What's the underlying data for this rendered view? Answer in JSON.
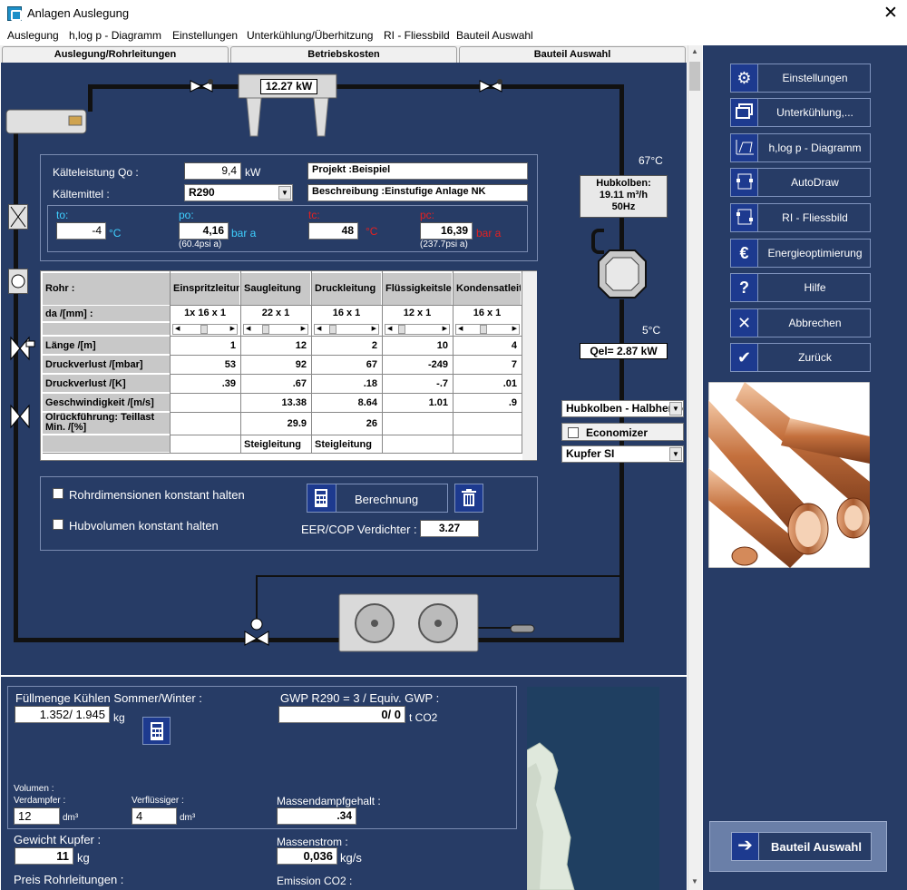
{
  "window": {
    "title": "Anlagen Auslegung",
    "close": "✕"
  },
  "menu": [
    "Auslegung",
    "h,log p - Diagramm",
    "Einstellungen",
    "Unterkühlung/Überhitzung",
    "RI - Fliessbild",
    "Bauteil Auswahl"
  ],
  "tabs": [
    "Auslegung/Rohrleitungen",
    "Betriebskosten",
    "Bauteil Auswahl"
  ],
  "diagram": {
    "condenser_power": "12.27 kW",
    "compressor_info": [
      "Hubkolben:",
      "19.11 m³/h",
      "50Hz"
    ],
    "temp_top": "67°C",
    "temp_mid": "5°C",
    "qel": "Qel= 2.87 kW"
  },
  "params": {
    "kaelteleistung_label": "Kälteleistung Qo :",
    "kaelteleistung_value": "9,4",
    "kaelteleistung_unit": "kW",
    "kaeltemittel_label": "Kältemittel :",
    "kaeltemittel_value": "R290",
    "projekt": "Projekt :Beispiel",
    "beschreibung": "Beschreibung :Einstufige Anlage NK",
    "to_label": "to:",
    "to_value": "-4",
    "to_unit": "°C",
    "po_label": "po:",
    "po_value": "4,16",
    "po_unit": "bar a",
    "po_psi": "(60.4psi a)",
    "tc_label": "tc:",
    "tc_value": "48",
    "tc_unit": "°C",
    "pc_label": "pc:",
    "pc_value": "16,39",
    "pc_unit": "bar a",
    "pc_psi": "(237.7psi a)"
  },
  "table": {
    "headers": [
      "Rohr :",
      "Einspritzleitung",
      "Saugleitung",
      "Druckleitung",
      "Flüssigkeitsleitung",
      "Kondensatleitung"
    ],
    "rows": [
      {
        "label": "da  /[mm] :",
        "values": [
          "1x 16 x 1",
          "22 x 1",
          "16 x 1",
          "12 x 1",
          "16 x 1"
        ]
      },
      {
        "label": "Länge /[m]",
        "values": [
          "1",
          "12",
          "2",
          "10",
          "4"
        ]
      },
      {
        "label": "Druckverlust /[mbar]",
        "values": [
          "53",
          "92",
          "67",
          "-249",
          "7"
        ]
      },
      {
        "label": "Druckverlust /[K]",
        "values": [
          ".39",
          ".67",
          ".18",
          "-.7",
          ".01"
        ]
      },
      {
        "label": "Geschwindigkeit /[m/s]",
        "values": [
          "",
          "13.38",
          "8.64",
          "1.01",
          ".9"
        ]
      },
      {
        "label": "Ölrückführung: Teillast Min. /[%]",
        "values": [
          "",
          "29.9",
          "26",
          "",
          ""
        ]
      },
      {
        "label": "",
        "values": [
          "",
          "Steigleitung",
          "Steigleitung",
          "",
          ""
        ]
      }
    ]
  },
  "options": {
    "rohrdim_label": "Rohrdimensionen konstant halten",
    "hubvol_label": "Hubvolumen konstant halten",
    "berechnung_label": "Berechnung",
    "eer_label": "EER/COP Verdichter :",
    "eer_value": "3.27"
  },
  "side_controls": {
    "compressor_type": "Hubkolben - Halbhermetisch",
    "economizer_label": "Economizer",
    "material": "Kupfer SI"
  },
  "lower": {
    "fuellmenge_label": "Füllmenge Kühlen Sommer/Winter :",
    "fuellmenge_value": "1.352/ 1.945",
    "fuellmenge_unit": "kg",
    "gwp_label": "GWP R290 = 3 / Equiv. GWP :",
    "gwp_value": "0/ 0",
    "gwp_unit": "t CO2",
    "volumen_label": "Volumen :",
    "verdampfer_label": "Verdampfer :",
    "verdampfer_value": "12",
    "verdampfer_unit": "dm³",
    "verfluessiger_label": "Verflüssiger :",
    "verfluessiger_value": "4",
    "verfluessiger_unit": "dm³",
    "massendampf_label": "Massendampfgehalt :",
    "massendampf_value": ".34",
    "gewicht_label": "Gewicht Kupfer :",
    "gewicht_value": "11",
    "gewicht_unit": "kg",
    "massenstrom_label": "Massenstrom :",
    "massenstrom_value": "0,036",
    "massenstrom_unit": "kg/s",
    "preis_label": "Preis Rohrleitungen :",
    "emission_label": "Emission CO2 :"
  },
  "right_buttons": [
    {
      "label": "Einstellungen",
      "icon": "gear-icon"
    },
    {
      "label": "Unterkühlung,...",
      "icon": "windows-icon"
    },
    {
      "label": "h,log p - Diagramm",
      "icon": "diagram-icon"
    },
    {
      "label": "AutoDraw",
      "icon": "autodraw-icon"
    },
    {
      "label": "RI - Fliessbild",
      "icon": "flowchart-icon"
    },
    {
      "label": "Energieoptimierung",
      "icon": "euro-icon"
    },
    {
      "label": "Hilfe",
      "icon": "question-icon"
    },
    {
      "label": "Abbrechen",
      "icon": "x-icon"
    },
    {
      "label": "Zurück",
      "icon": "check-icon"
    }
  ],
  "bauteil_button": "Bauteil Auswahl"
}
